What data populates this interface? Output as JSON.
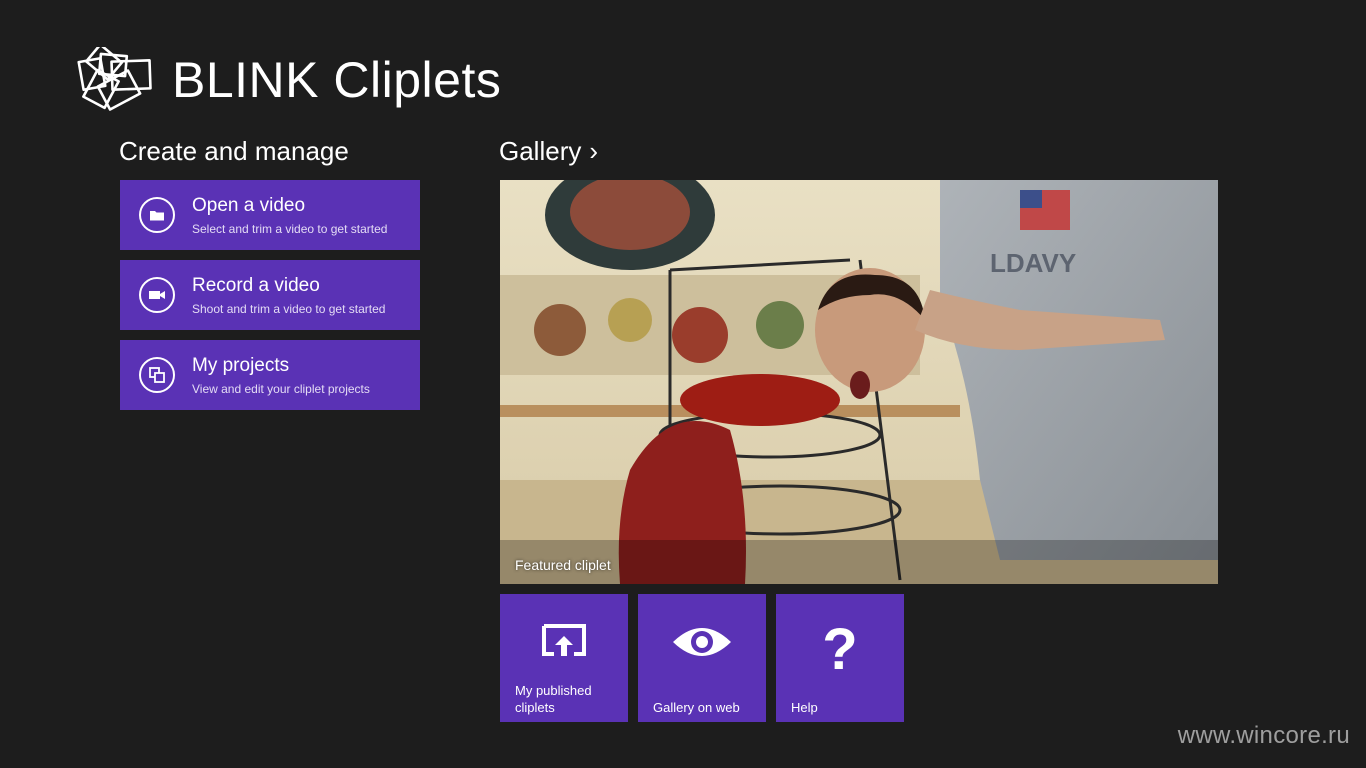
{
  "app": {
    "title": "BLINK Cliplets",
    "logo_icon": "blink-cliplets-logo-icon"
  },
  "create_section": {
    "heading": "Create and manage",
    "items": [
      {
        "icon": "folder-icon",
        "title": "Open a video",
        "subtitle": "Select and trim a video to get started"
      },
      {
        "icon": "video-camera-icon",
        "title": "Record a video",
        "subtitle": "Shoot and trim a video to get started"
      },
      {
        "icon": "projects-icon",
        "title": "My projects",
        "subtitle": "View and edit your cliplet projects"
      }
    ]
  },
  "gallery_section": {
    "heading": "Gallery",
    "chevron": "›",
    "featured": {
      "label": "Featured cliplet"
    },
    "tiles": [
      {
        "icon": "publish-icon",
        "label": "My published cliplets"
      },
      {
        "icon": "eye-icon",
        "label": "Gallery on web"
      },
      {
        "icon": "help-icon",
        "glyph": "?",
        "label": "Help"
      }
    ]
  },
  "watermark": "www.wincore.ru",
  "colors": {
    "background": "#1d1d1d",
    "accent": "#5a32b5",
    "text": "#ffffff"
  }
}
